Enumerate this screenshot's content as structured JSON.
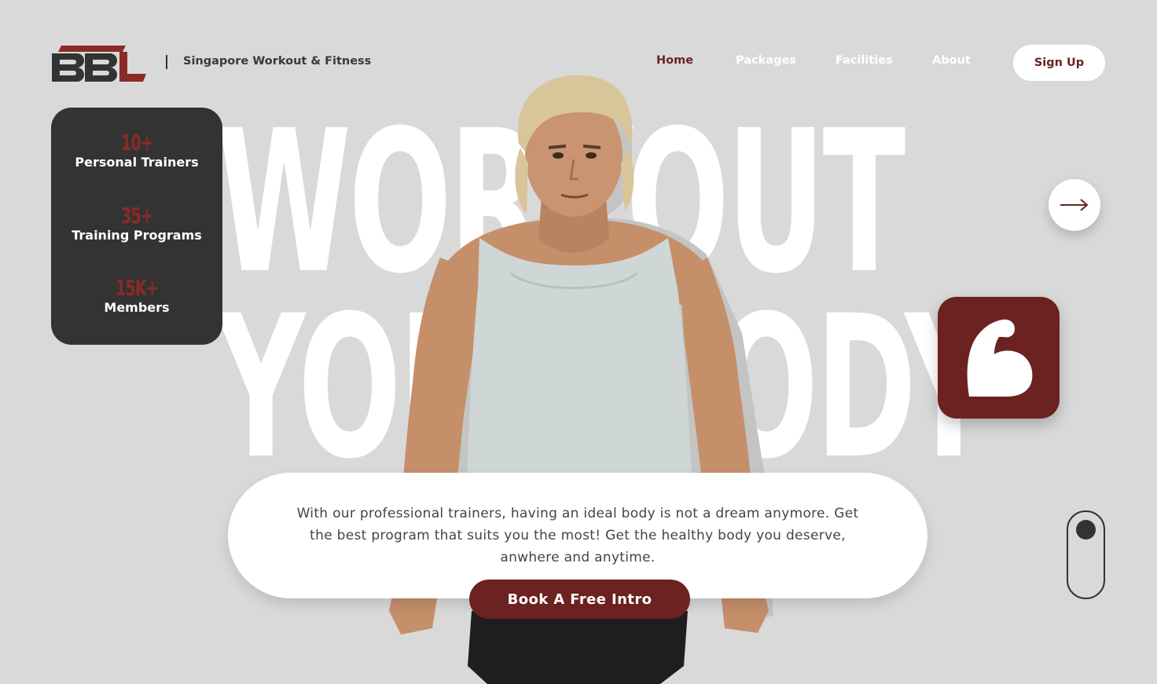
{
  "brand": {
    "logo_text": "BBL",
    "tagline": "Singapore Workout & Fitness",
    "primary_color": "#6b2220",
    "dark_color": "#333333",
    "background_color": "#d9d9d9"
  },
  "nav": {
    "items": [
      {
        "label": "Home",
        "active": true
      },
      {
        "label": "Packages",
        "active": false
      },
      {
        "label": "Facilities",
        "active": false
      },
      {
        "label": "About",
        "active": false
      }
    ],
    "signup_label": "Sign Up"
  },
  "stats": [
    {
      "value": "10+",
      "label": "Personal Trainers"
    },
    {
      "value": "35+",
      "label": "Training Programs"
    },
    {
      "value": "15K+",
      "label": "Members"
    }
  ],
  "hero": {
    "headline_line1": "WORKOUT",
    "headline_line2": "YOUR BODY",
    "description": "With our professional trainers, having an ideal body is not a dream anymore. Get the best program that suits you the most! Get the healthy body you deserve, anwhere and anytime.",
    "cta_label": "Book A Free Intro"
  },
  "icons": {
    "next": "arrow-right-icon",
    "feature": "flexed-bicep-icon",
    "scroll": "scroll-indicator-icon"
  }
}
